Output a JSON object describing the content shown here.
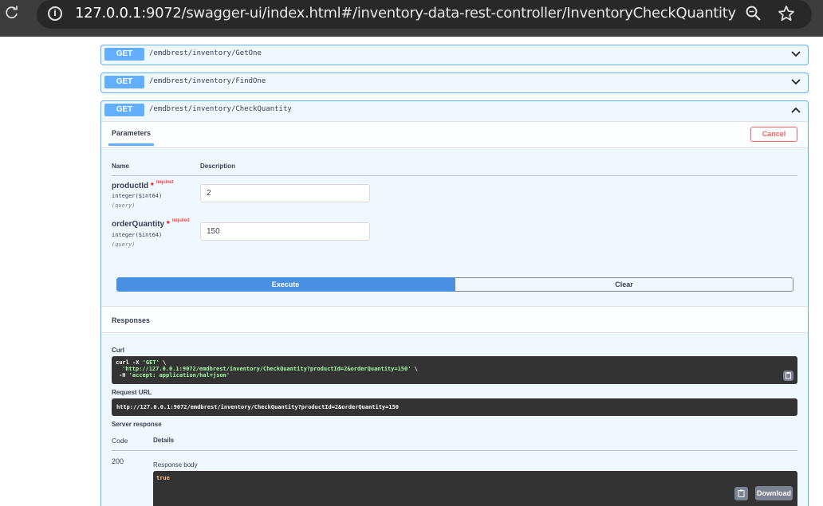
{
  "browser": {
    "url_host": "127.0.0.1",
    "url_rest": ":9072/swagger-ui/index.html#/inventory-data-rest-controller/InventoryCheckQuantity"
  },
  "operations": [
    {
      "method": "GET",
      "path": "/emdbrest/inventory/GetOne"
    },
    {
      "method": "GET",
      "path": "/emdbrest/inventory/FindOne"
    },
    {
      "method": "GET",
      "path": "/emdbrest/inventory/CheckQuantity"
    }
  ],
  "params_section": {
    "tab": "Parameters",
    "cancel": "Cancel",
    "col_name": "Name",
    "col_description": "Description",
    "params": [
      {
        "name": "productId",
        "star": "*",
        "required": "required",
        "type": "integer($int64)",
        "in": "(query)",
        "value": "2"
      },
      {
        "name": "orderQuantity",
        "star": "*",
        "required": "required",
        "type": "integer($int64)",
        "in": "(query)",
        "value": "150"
      }
    ],
    "execute": "Execute",
    "clear": "Clear"
  },
  "responses": {
    "title": "Responses",
    "curl_label": "Curl",
    "curl_line1_cmd": "curl -X ",
    "curl_line1_str": "'GET'",
    "curl_line1_end": " \\",
    "curl_line2_str": "'http://127.0.0.1:9072/emdbrest/inventory/CheckQuantity?productId=2&orderQuantity=150'",
    "curl_line2_end": " \\",
    "curl_line3_cmd": "-H ",
    "curl_line3_str": "'accept: application/hal+json'",
    "request_url_label": "Request URL",
    "request_url": "http://127.0.0.1:9072/emdbrest/inventory/CheckQuantity?productId=2&orderQuantity=150",
    "server_response_label": "Server response",
    "col_code": "Code",
    "col_details": "Details",
    "code": "200",
    "response_body_label": "Response body",
    "response_body": "true",
    "download": "Download"
  },
  "colors": {
    "get_blue": "#61affe",
    "execute_blue": "#4990e2",
    "cancel_red": "#ff6060"
  }
}
